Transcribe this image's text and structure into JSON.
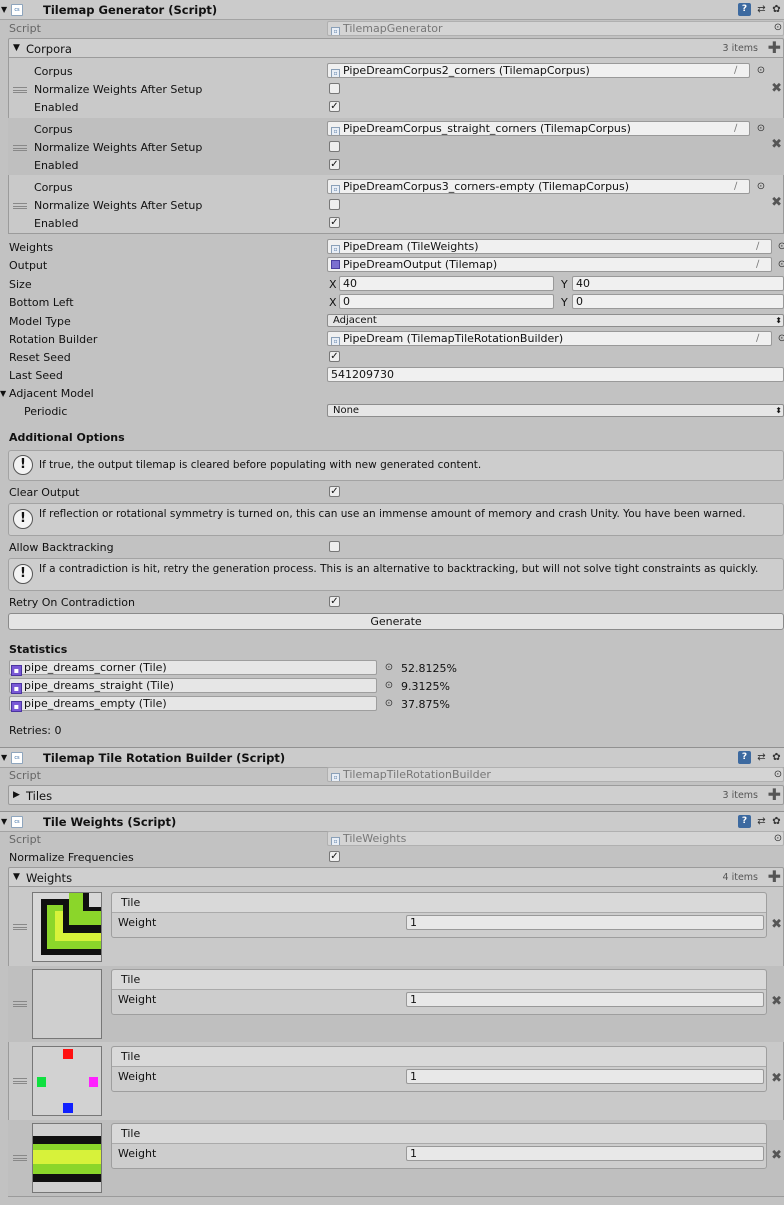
{
  "tilemap_generator": {
    "title": "Tilemap Generator (Script)",
    "script_label": "Script",
    "script_value": "TilemapGenerator",
    "corpora": {
      "label": "Corpora",
      "count": "3 items",
      "items": [
        {
          "corpus_label": "Corpus",
          "corpus_value": "PipeDreamCorpus2_corners (TilemapCorpus)",
          "normalize_label": "Normalize Weights After Setup",
          "normalize_checked": false,
          "enabled_label": "Enabled",
          "enabled_checked": true
        },
        {
          "corpus_label": "Corpus",
          "corpus_value": "PipeDreamCorpus_straight_corners (TilemapCorpus)",
          "normalize_label": "Normalize Weights After Setup",
          "normalize_checked": false,
          "enabled_label": "Enabled",
          "enabled_checked": true
        },
        {
          "corpus_label": "Corpus",
          "corpus_value": "PipeDreamCorpus3_corners-empty (TilemapCorpus)",
          "normalize_label": "Normalize Weights After Setup",
          "normalize_checked": false,
          "enabled_label": "Enabled",
          "enabled_checked": true
        }
      ]
    },
    "weights_label": "Weights",
    "weights_value": "PipeDream (TileWeights)",
    "output_label": "Output",
    "output_value": "PipeDreamOutput (Tilemap)",
    "size_label": "Size",
    "size_x_label": "X",
    "size_x": "40",
    "size_y_label": "Y",
    "size_y": "40",
    "bottom_left_label": "Bottom Left",
    "bl_x_label": "X",
    "bl_x": "0",
    "bl_y_label": "Y",
    "bl_y": "0",
    "model_type_label": "Model Type",
    "model_type_value": "Adjacent",
    "rotation_builder_label": "Rotation Builder",
    "rotation_builder_value": "PipeDream (TilemapTileRotationBuilder)",
    "reset_seed_label": "Reset Seed",
    "reset_seed_checked": true,
    "last_seed_label": "Last Seed",
    "last_seed_value": "541209730",
    "adjacent_model_label": "Adjacent Model",
    "periodic_label": "Periodic",
    "periodic_value": "None",
    "additional_options_label": "Additional Options",
    "help_clear": "If true, the output tilemap is cleared before populating with new generated content.",
    "clear_output_label": "Clear Output",
    "clear_output_checked": true,
    "help_backtrack": "If reflection or rotational symmetry is turned on, this can use an immense amount of memory and crash Unity. You have been warned.",
    "allow_backtracking_label": "Allow Backtracking",
    "allow_backtracking_checked": false,
    "help_retry": "If a contradiction is hit, retry the generation process. This is an alternative to backtracking, but will not solve tight constraints as quickly.",
    "retry_label": "Retry On Contradiction",
    "retry_checked": true,
    "generate_label": "Generate",
    "statistics_label": "Statistics",
    "stats": [
      {
        "tile": "pipe_dreams_corner (Tile)",
        "percent": "52.8125%"
      },
      {
        "tile": "pipe_dreams_straight (Tile)",
        "percent": "9.3125%"
      },
      {
        "tile": "pipe_dreams_empty (Tile)",
        "percent": "37.875%"
      }
    ],
    "retries_label": "Retries: 0"
  },
  "rotation_builder": {
    "title": "Tilemap Tile Rotation Builder (Script)",
    "script_label": "Script",
    "script_value": "TilemapTileRotationBuilder",
    "tiles_label": "Tiles",
    "tiles_count": "3 items"
  },
  "tile_weights": {
    "title": "Tile Weights (Script)",
    "script_label": "Script",
    "script_value": "TileWeights",
    "normalize_label": "Normalize Frequencies",
    "normalize_checked": true,
    "weights_label": "Weights",
    "weights_count": "4 items",
    "items": [
      {
        "tile_label": "Tile",
        "weight_label": "Weight",
        "weight_value": "1",
        "thumb": "corner-pipe-icon"
      },
      {
        "tile_label": "Tile",
        "weight_label": "Weight",
        "weight_value": "1",
        "thumb": "empty-tile-icon"
      },
      {
        "tile_label": "Tile",
        "weight_label": "Weight",
        "weight_value": "1",
        "thumb": "color-dots-icon"
      },
      {
        "tile_label": "Tile",
        "weight_label": "Weight",
        "weight_value": "1",
        "thumb": "straight-pipe-icon"
      }
    ]
  },
  "colors": {
    "accent": "#3d6aa0",
    "panel": "#c2c2c2",
    "tile_icon": "#7a59d6"
  }
}
